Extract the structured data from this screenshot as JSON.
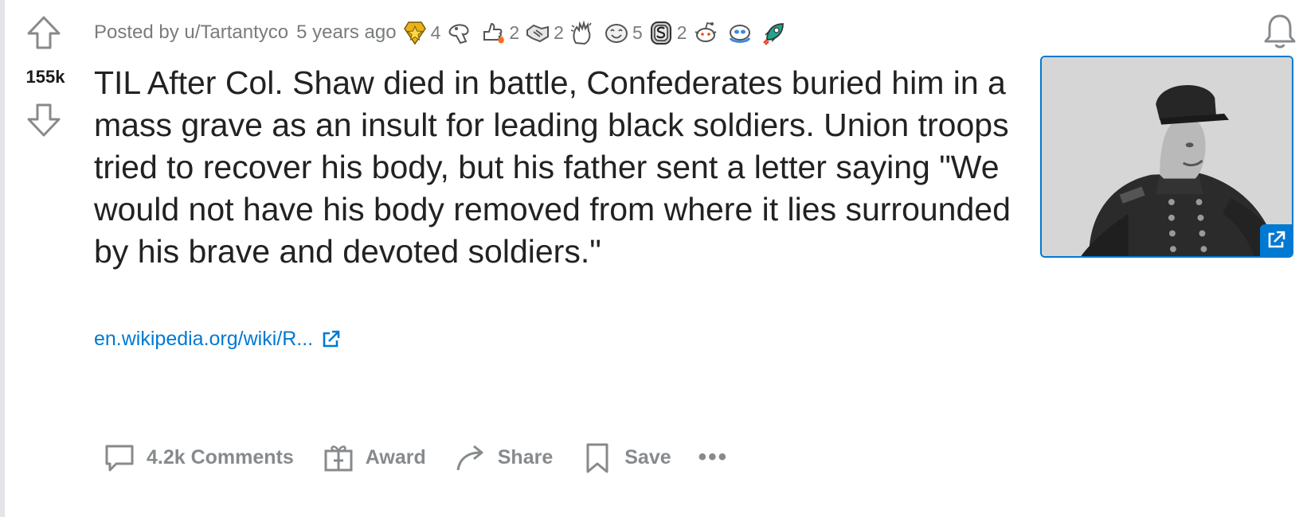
{
  "post": {
    "score": "155k",
    "meta": {
      "posted_by": "Posted by u/Tartantyco",
      "age": "5 years ago"
    },
    "awards": [
      {
        "icon": "gold-star-award-icon",
        "count": "4"
      },
      {
        "icon": "wholesome-hand-award-icon",
        "count": ""
      },
      {
        "icon": "thumbs-flame-award-icon",
        "count": "2"
      },
      {
        "icon": "handshake-award-icon",
        "count": "2"
      },
      {
        "icon": "clapping-hands-award-icon",
        "count": ""
      },
      {
        "icon": "laughing-face-award-icon",
        "count": "5"
      },
      {
        "icon": "silver-s-award-icon",
        "count": "2"
      },
      {
        "icon": "snoo-wave-award-icon",
        "count": ""
      },
      {
        "icon": "snoo-hug-award-icon",
        "count": ""
      },
      {
        "icon": "rocket-award-icon",
        "count": ""
      }
    ],
    "title": "TIL After Col. Shaw died in battle, Confederates buried him in a mass grave as an insult for leading black soldiers. Union troops tried to recover his body, but his father sent a letter saying \"We would not have his body removed from where it lies surrounded by his brave and devoted soldiers.\"",
    "link_text": "en.wikipedia.org/wiki/R...",
    "actions": {
      "comments": "4.2k Comments",
      "award": "Award",
      "share": "Share",
      "save": "Save",
      "more": "•••"
    }
  },
  "colors": {
    "link": "#0079d3",
    "muted": "#787c7e",
    "title": "#222222"
  }
}
